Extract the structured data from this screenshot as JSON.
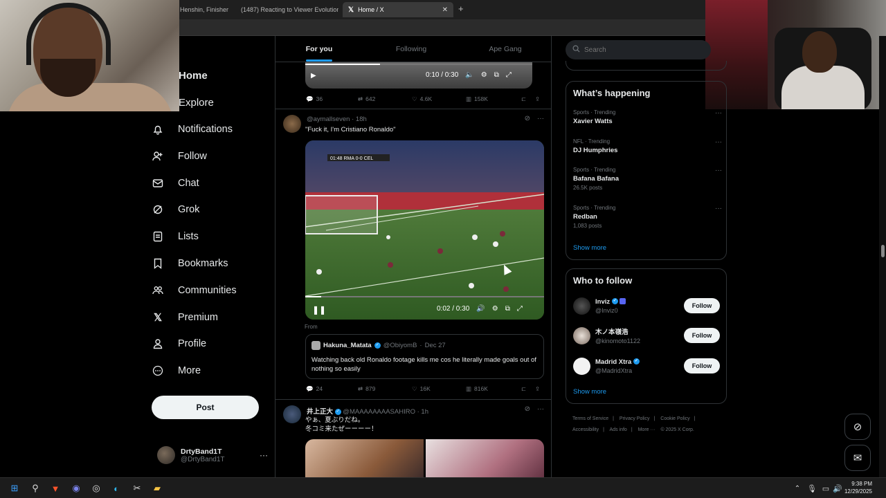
{
  "browser": {
    "tabs": [
      {
        "label": "Henshin, Finisher",
        "active": false
      },
      {
        "label": "(1487) Reacting to Viewer Evolutions",
        "active": false
      },
      {
        "label": "Home / X",
        "active": true
      }
    ],
    "new_tab": "+"
  },
  "sidebar": {
    "items": [
      {
        "label": "Home",
        "icon": "home-icon"
      },
      {
        "label": "Explore",
        "icon": "search-icon"
      },
      {
        "label": "Notifications",
        "icon": "bell-icon"
      },
      {
        "label": "Follow",
        "icon": "person-add-icon"
      },
      {
        "label": "Chat",
        "icon": "mail-icon"
      },
      {
        "label": "Grok",
        "icon": "grok-icon"
      },
      {
        "label": "Lists",
        "icon": "list-icon"
      },
      {
        "label": "Bookmarks",
        "icon": "bookmark-icon"
      },
      {
        "label": "Communities",
        "icon": "people-icon"
      },
      {
        "label": "Premium",
        "icon": "x-logo-icon"
      },
      {
        "label": "Profile",
        "icon": "person-icon"
      },
      {
        "label": "More",
        "icon": "more-circle-icon"
      }
    ],
    "post_label": "Post",
    "account": {
      "name": "DrtyBand1T",
      "handle": "@DrtyBand1T"
    }
  },
  "feed": {
    "tabs": [
      "For you",
      "Following",
      "Ape Gang"
    ],
    "first_video": {
      "time": "0:10 / 0:30",
      "progress": 0.33
    },
    "first_actions": {
      "replies": "36",
      "reposts": "642",
      "likes": "4.6K",
      "views": "158K"
    },
    "tweet2": {
      "handle": "@aymallseven",
      "time": "18h",
      "text": "\"Fuck it, I'm Cristiano Ronaldo\"",
      "video_time": "0:02 / 0:30",
      "scoreboard": "01:48 RMA 0-0 CEL",
      "from_label": "From",
      "quote": {
        "name": "Hakuna_Matata",
        "handle": "@ObiyomB",
        "date": "Dec 27",
        "text": "Watching back old Ronaldo footage kills me cos he literally made goals out of nothing so easily"
      },
      "actions": {
        "replies": "24",
        "reposts": "879",
        "likes": "16K",
        "views": "816K"
      }
    },
    "tweet3": {
      "name": "井上正大",
      "handle": "@MAAAAAAAASAHIRO",
      "time": "1h",
      "line1": "やぁ、夏ぶりだね。",
      "line2": "冬コミ来たぜーーーー！"
    }
  },
  "right": {
    "search_placeholder": "Search",
    "happening": {
      "title": "What’s happening",
      "trends": [
        {
          "meta": "Sports · Trending",
          "name": "Xavier Watts",
          "count": ""
        },
        {
          "meta": "NFL · Trending",
          "name": "DJ Humphries",
          "count": ""
        },
        {
          "meta": "Sports · Trending",
          "name": "Bafana Bafana",
          "count": "26.5K posts"
        },
        {
          "meta": "Sports · Trending",
          "name": "Redban",
          "count": "1,083 posts"
        }
      ],
      "show_more": "Show more"
    },
    "who_to_follow": {
      "title": "Who to follow",
      "users": [
        {
          "name": "Inviz",
          "handle": "@Inviz0",
          "button": "Follow"
        },
        {
          "name": "木ノ本嶺浩",
          "handle": "@kinomoto1122",
          "button": "Follow"
        },
        {
          "name": "Madrid Xtra",
          "handle": "@MadridXtra",
          "button": "Follow"
        }
      ],
      "show_more": "Show more"
    },
    "footer": [
      "Terms of Service",
      "|",
      "Privacy Policy",
      "|",
      "Cookie Policy",
      "|",
      "Accessibility",
      "|",
      "Ads info",
      "|",
      "More ···",
      "© 2025 X Corp."
    ]
  },
  "taskbar": {
    "time": "9:38 PM",
    "date": "12/29/2025"
  },
  "colors": {
    "accent": "#1d9bf0",
    "background": "#000000",
    "border": "#2f3336",
    "muted": "#71767b"
  }
}
